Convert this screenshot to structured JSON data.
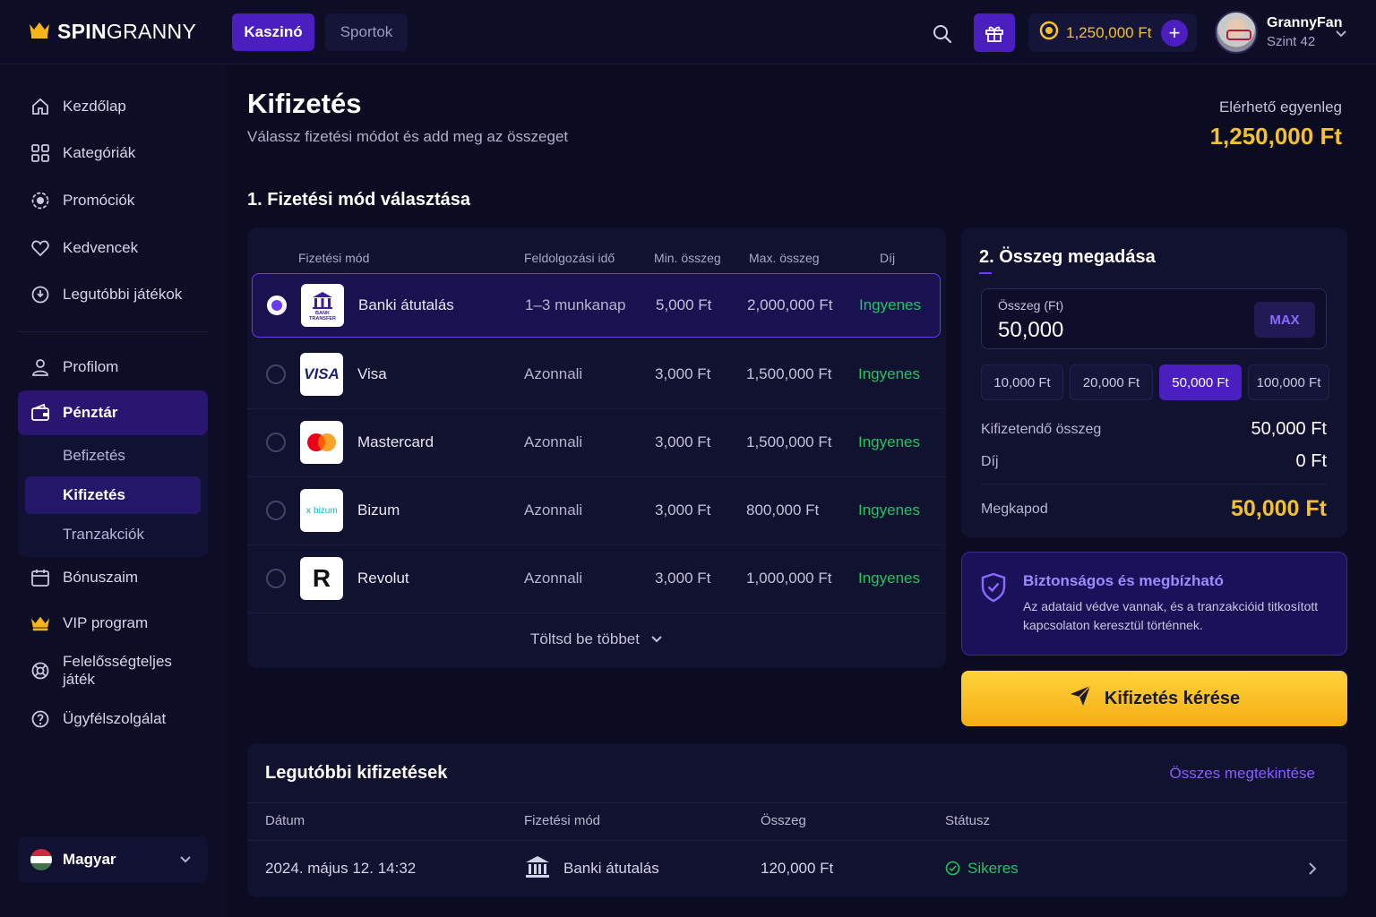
{
  "brand": {
    "name_bold": "SPIN",
    "name_light": "GRANNY"
  },
  "topnav": {
    "casino": "Kaszinó",
    "sports": "Sportok"
  },
  "header": {
    "balance": "1,250,000 Ft",
    "plus": "+",
    "username": "GrannyFan",
    "level": "Szint 42"
  },
  "sidebar": {
    "items": [
      {
        "label": "Kezdőlap",
        "icon": "home-icon"
      },
      {
        "label": "Kategóriák",
        "icon": "grid-icon"
      },
      {
        "label": "Promóciók",
        "icon": "promo-icon"
      },
      {
        "label": "Kedvencek",
        "icon": "heart-icon"
      },
      {
        "label": "Legutóbbi játékok",
        "icon": "history-icon"
      }
    ],
    "profile": "Profilom",
    "cashier": "Pénztár",
    "cashier_sub": [
      "Befizetés",
      "Kifizetés",
      "Tranzakciók"
    ],
    "items2": [
      {
        "label": "Bónuszaim",
        "icon": "calendar-icon"
      },
      {
        "label": "VIP program",
        "icon": "crown-icon"
      },
      {
        "label": "Felelősségteljes játék",
        "icon": "support-icon"
      },
      {
        "label": "Ügyfélszolgálat",
        "icon": "help-icon"
      }
    ],
    "language": "Magyar"
  },
  "page": {
    "title": "Kifizetés",
    "subtitle": "Válassz fizetési módot és add meg az összeget",
    "available_label": "Elérhető egyenleg",
    "available_value": "1,250,000 Ft"
  },
  "methods": {
    "section_title": "1. Fizetési mód választása",
    "headers": [
      "Fizetési mód",
      "Feldolgozási idő",
      "Min. összeg",
      "Max. összeg",
      "Díj"
    ],
    "rows": [
      {
        "name": "Banki átutalás",
        "time": "1–3 munkanap",
        "min": "5,000 Ft",
        "max": "2,000,000 Ft",
        "fee": "Ingyenes",
        "selected": true,
        "logo_text": "BANK TRANSFER"
      },
      {
        "name": "Visa",
        "time": "Azonnali",
        "min": "3,000 Ft",
        "max": "1,500,000 Ft",
        "fee": "Ingyenes",
        "selected": false,
        "logo_text": "VISA"
      },
      {
        "name": "Mastercard",
        "time": "Azonnali",
        "min": "3,000 Ft",
        "max": "1,500,000 Ft",
        "fee": "Ingyenes",
        "selected": false,
        "logo_text": ""
      },
      {
        "name": "Bizum",
        "time": "Azonnali",
        "min": "3,000 Ft",
        "max": "800,000 Ft",
        "fee": "Ingyenes",
        "selected": false,
        "logo_text": "bizum"
      },
      {
        "name": "Revolut",
        "time": "Azonnali",
        "min": "3,000 Ft",
        "max": "1,000,000 Ft",
        "fee": "Ingyenes",
        "selected": false,
        "logo_text": "R"
      }
    ],
    "load_more": "Töltsd be többet"
  },
  "amount": {
    "section_title": "2. Összeg megadása",
    "field_label": "Összeg (Ft)",
    "field_value": "50,000",
    "max_label": "MAX",
    "presets": [
      "10,000 Ft",
      "20,000 Ft",
      "50,000 Ft",
      "100,000 Ft"
    ],
    "selected_preset": "50,000 Ft",
    "payout_label": "Kifizetendő összeg",
    "payout_value": "50,000 Ft",
    "fee_label": "Díj",
    "fee_value": "0 Ft",
    "receive_label": "Megkapod",
    "receive_value": "50,000 Ft"
  },
  "security": {
    "title": "Biztonságos és megbízható",
    "desc": "Az adataid védve vannak, és a tranzakcióid titkosított kapcsolaton keresztül történnek."
  },
  "cta": {
    "label": "Kifizetés kérése"
  },
  "recent": {
    "title": "Legutóbbi kifizetések",
    "view_all": "Összes megtekintése",
    "headers": [
      "Dátum",
      "Fizetési mód",
      "Összeg",
      "Státusz"
    ],
    "rows": [
      {
        "date": "2024. május 12.  14:32",
        "method": "Banki átutalás",
        "amount": "120,000 Ft",
        "status": "Sikeres"
      }
    ]
  },
  "colors": {
    "accent": "#4b1fbf",
    "gold": "#f3c12b",
    "success": "#22c55e",
    "bg": "#0b0b22"
  }
}
